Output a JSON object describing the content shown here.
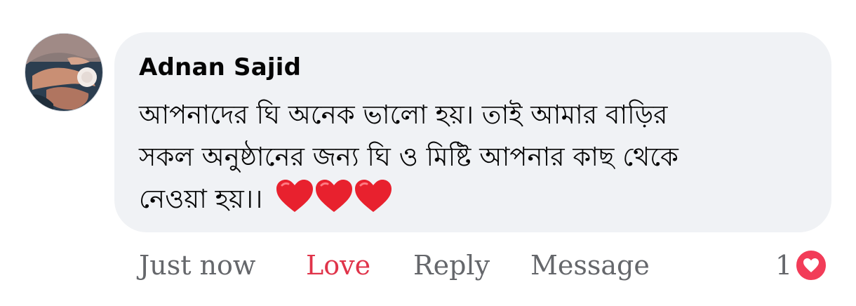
{
  "comment": {
    "author": "Adnan Sajid",
    "text_lines": [
      "আপনাদের ঘি অনেক ভালো হয়। তাই আমার বাড়ির",
      "সকল অনুষ্ঠানের জন্য ঘি ও মিষ্টি  আপনার কাছ থেকে",
      "নেওয়া হয়।।"
    ],
    "emoji": [
      "red-heart",
      "red-heart",
      "red-heart"
    ],
    "avatar_icon": "profile-photo"
  },
  "actions": {
    "timestamp": "Just now",
    "love_label": "Love",
    "reply_label": "Reply",
    "message_label": "Message"
  },
  "reactions": {
    "count": "1",
    "type": "love",
    "icon": "heart-icon"
  },
  "colors": {
    "bubble": "#f0f2f5",
    "love_active": "#e0344a",
    "muted": "#65676b",
    "badge": "#f23c58"
  }
}
